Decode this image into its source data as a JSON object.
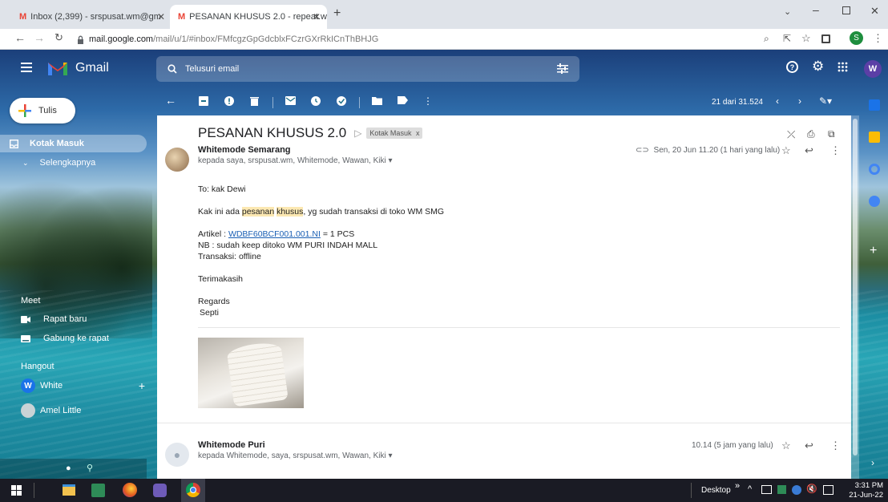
{
  "browser": {
    "tabs": [
      {
        "label": "Inbox (2,399) - srspusat.wm@gm",
        "active": false
      },
      {
        "label": "PESANAN KHUSUS 2.0 - repeat.w",
        "active": true
      }
    ],
    "new_tab": "+",
    "url_host": "mail.google.com",
    "url_rest": "/mail/u/1/#inbox/FMfcgzGpGdcblxFCzrGXrRkICnThBHJG",
    "profile_initial": "S"
  },
  "gmail": {
    "logo_text": "Gmail",
    "search_placeholder": "Telusuri email",
    "account_initial": "W",
    "compose_label": "Tulis",
    "nav": [
      {
        "label": "Kotak Masuk",
        "selected": true
      },
      {
        "label": "Selengkapnya",
        "selected": false
      }
    ],
    "meet": {
      "header": "Meet",
      "items": [
        "Rapat baru",
        "Gabung ke rapat"
      ]
    },
    "hangout": {
      "header": "Hangout",
      "contacts": [
        {
          "initial": "W",
          "name": "White"
        },
        {
          "initial": "",
          "name": "Amel Little"
        }
      ]
    },
    "pagination": "21 dari 31.524"
  },
  "thread": {
    "subject": "PESANAN KHUSUS 2.0",
    "label": "Kotak Masuk",
    "label_close": "x",
    "messages": [
      {
        "sender": "Whitemode Semarang",
        "recipients": "kepada saya, srspusat.wm, Whitemode, Wawan, Kiki",
        "date": "Sen, 20 Jun 11.20 (1 hari yang lalu)",
        "body": {
          "greeting": "To: kak Dewi",
          "intro_pre": "Kak ini ada ",
          "intro_hl1": "pesanan",
          "intro_sp": " ",
          "intro_hl2": "khusus",
          "intro_post": ", yg sudah transaksi di toko WM SMG",
          "artikel_label": "Artikel : ",
          "artikel_link": "WDBF60BCF001.001.NI",
          "artikel_qty": " = 1 PCS",
          "nb": "NB : sudah keep ditoko WM PURI INDAH MALL",
          "transaksi": "Transaksi: offline",
          "thanks": "Terimakasih",
          "regards": "Regards",
          "signature": "Septi"
        }
      },
      {
        "sender": "Whitemode Puri",
        "recipients": "kepada Whitemode, saya, srspusat.wm, Wawan, Kiki",
        "date": "10.14 (5 jam yang lalu)"
      }
    ]
  },
  "taskbar": {
    "desktop_label": "Desktop",
    "chevrons": "»",
    "time": "3:31 PM",
    "date": "21-Jun-22"
  },
  "colors": {
    "gmail_red": "#ea4335",
    "link_blue": "#1a5fb4",
    "highlight": "#fce8b2",
    "avatar_purple": "#5b3fa6",
    "taskbar_bg": "#1a1b24"
  }
}
